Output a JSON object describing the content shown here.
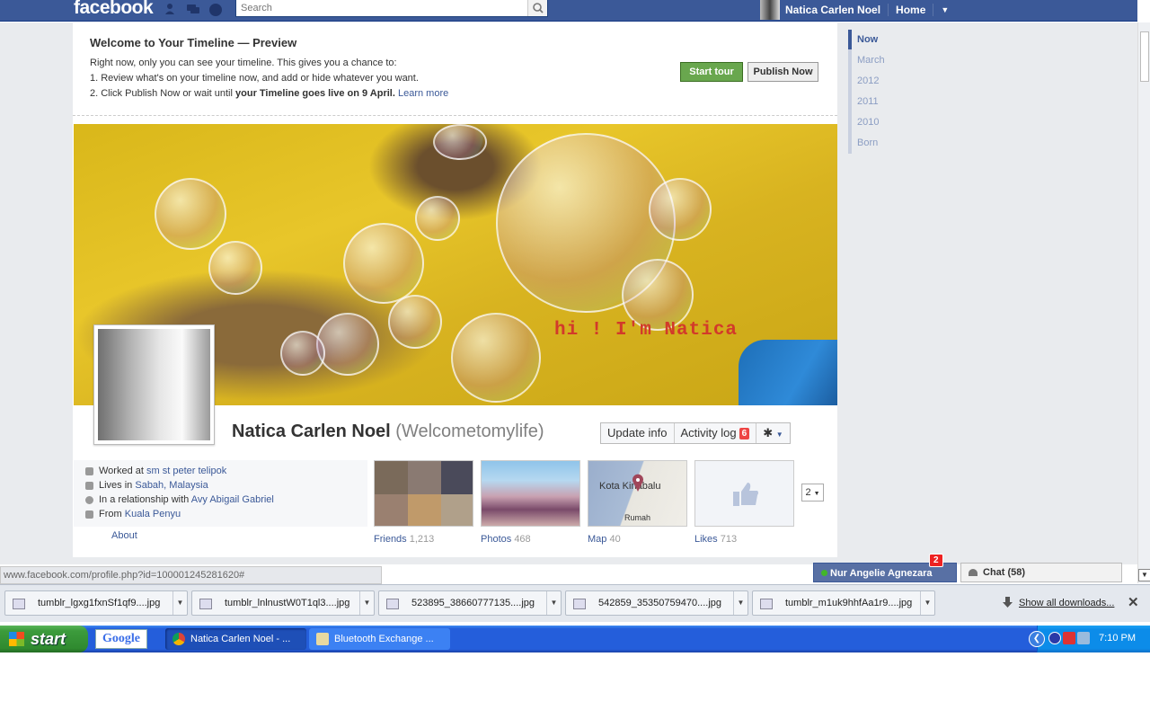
{
  "fb": {
    "logo": "facebook",
    "search_placeholder": "Search",
    "user_name": "Natica Carlen Noel",
    "home": "Home"
  },
  "preview": {
    "title": "Welcome to Your Timeline — Preview",
    "line1": "Right now, only you can see your timeline. This gives you a chance to:",
    "line2": "1. Review what's on your timeline now, and add or hide whatever you want.",
    "line3_pre": "2. Click Publish Now or wait until ",
    "line3_bold": "your Timeline goes live on 9 April.",
    "learn_more": "Learn more",
    "start_tour": "Start tour",
    "publish_now": "Publish Now"
  },
  "cover": {
    "caption": "hi ! I'm Natica"
  },
  "profile": {
    "name": "Natica Carlen Noel",
    "alt_name": "(Welcometomylife)",
    "update_info": "Update info",
    "activity_log": "Activity log",
    "activity_count": "6"
  },
  "info": {
    "worked_pre": "Worked at ",
    "worked_at": "sm st peter telipok",
    "lives_pre": "Lives in ",
    "lives_in": "Sabah, Malaysia",
    "rel_pre": "In a relationship with ",
    "rel_with": "Avy Abigail Gabriel",
    "from_pre": "From ",
    "from": "Kuala Penyu",
    "about": "About"
  },
  "apps": {
    "friends_label": "Friends",
    "friends_count": "1,213",
    "photos_label": "Photos",
    "photos_count": "468",
    "map_label": "Map",
    "map_count": "40",
    "map_city": "Kota Kinabalu",
    "map_place": "Rumah",
    "likes_label": "Likes",
    "likes_count": "713",
    "more": "2"
  },
  "timeline_nav": [
    "Now",
    "March",
    "2012",
    "2011",
    "2010",
    "Born"
  ],
  "status_url": "www.facebook.com/profile.php?id=100001245281620#",
  "chat": {
    "user": "Nur Angelie Agnezara",
    "badge": "2",
    "label": "Chat (58)"
  },
  "downloads": {
    "files": [
      "tumblr_lgxg1fxnSf1qf9....jpg",
      "tumblr_lnlnustW0T1ql3....jpg",
      "523895_38660777135....jpg",
      "542859_35350759470....jpg",
      "tumblr_m1uk9hhfAa1r9....jpg"
    ],
    "show_all": "Show all downloads..."
  },
  "taskbar": {
    "start": "start",
    "google": "Google",
    "task1": "Natica Carlen Noel - ...",
    "task2": "Bluetooth Exchange ...",
    "time": "7:10 PM"
  },
  "colors": {
    "fb_blue": "#3b5998",
    "link": "#3b5998",
    "start_green": "#69a74e",
    "badge_red": "#e44"
  }
}
